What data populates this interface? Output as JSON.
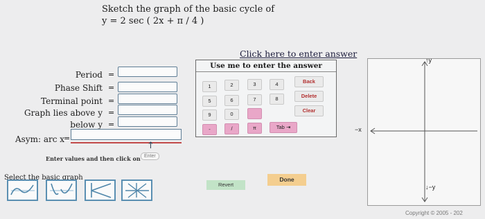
{
  "question": {
    "line1": "Sketch the graph of the basic cycle of",
    "line2": "y  =  2 sec ( 2x + π / 4 )"
  },
  "fields": [
    {
      "label": "Period",
      "value": ""
    },
    {
      "label": "Phase Shift",
      "value": ""
    },
    {
      "label": "Terminal point",
      "value": ""
    },
    {
      "label": "Graph lies above y",
      "value": ""
    },
    {
      "label": "below y",
      "value": ""
    }
  ],
  "equals": "=",
  "asymptote": {
    "label": "Asym: arc x",
    "value": ""
  },
  "instructions": {
    "text": "Enter values and then click on  →",
    "enter_button": "Enter"
  },
  "graph_select": {
    "label": "Select the basic graph",
    "options": [
      "cosecant-shape",
      "secant-shape",
      "cotangent-shape",
      "tangent-shape"
    ]
  },
  "keypad": {
    "link": "Click here to enter answer",
    "title": "Use me to enter the answer",
    "rows": [
      [
        "1",
        "2",
        "3",
        "4"
      ],
      [
        "5",
        "6",
        "7",
        "8"
      ],
      [
        "9",
        "0",
        "",
        ""
      ],
      [
        "-",
        "/",
        "π",
        "Tab ⇥"
      ]
    ],
    "actions": [
      "Back",
      "Delete",
      "Clear"
    ]
  },
  "buttons": {
    "revert": "Revert",
    "done": "Done"
  },
  "graph_axes": {
    "top": "↑y",
    "bottom": "↓−y",
    "left": "−x"
  },
  "copyright": "Copyright © 2005 - 202",
  "colors": {
    "field_border": "#5e7d95",
    "pink_key": "#e9a7c8",
    "revert": "#c2e3c7",
    "done": "#f4ce8f"
  }
}
